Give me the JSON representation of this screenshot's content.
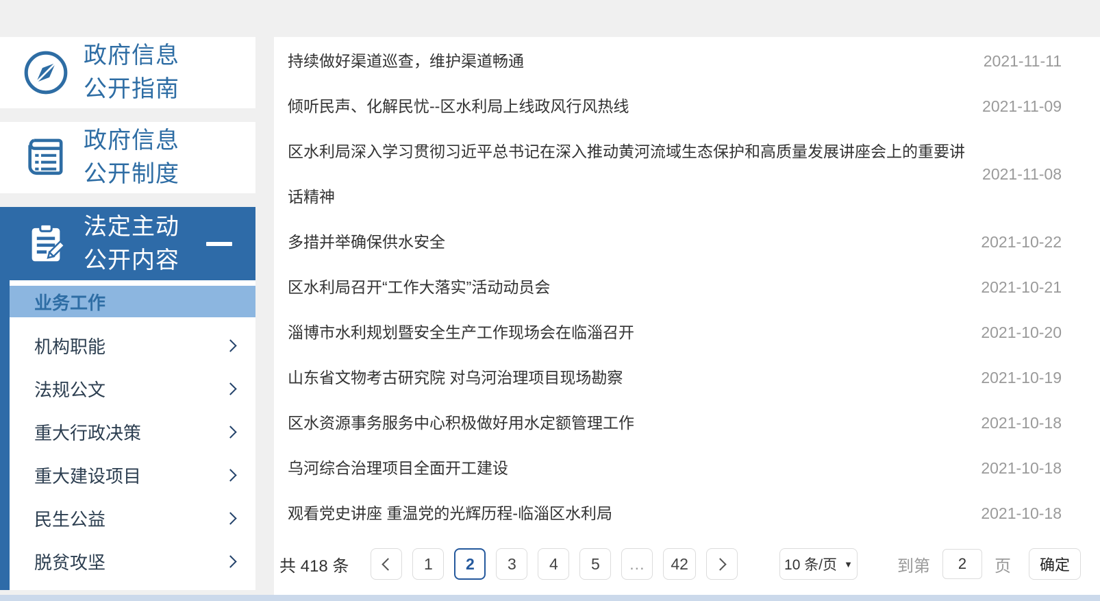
{
  "sidebar": {
    "nav": [
      {
        "line1": "政府信息",
        "line2": "公开指南",
        "icon": "compass-icon"
      },
      {
        "line1": "政府信息",
        "line2": "公开制度",
        "icon": "book-icon"
      },
      {
        "line1": "法定主动",
        "line2": "公开内容",
        "icon": "clipboard-pencil-icon",
        "state": "expanded"
      }
    ],
    "submenu": [
      {
        "label": "业务工作",
        "active": true
      },
      {
        "label": "机构职能"
      },
      {
        "label": "法规公文"
      },
      {
        "label": "重大行政决策"
      },
      {
        "label": "重大建设项目"
      },
      {
        "label": "民生公益"
      },
      {
        "label": "脱贫攻坚"
      }
    ]
  },
  "news": {
    "items": [
      {
        "title": "持续做好渠道巡查，维护渠道畅通",
        "date": "2021-11-11"
      },
      {
        "title": "倾听民声、化解民忧--区水利局上线政风行风热线",
        "date": "2021-11-09"
      },
      {
        "title": "区水利局深入学习贯彻习近平总书记在深入推动黄河流域生态保护和高质量发展讲座会上的重要讲话精神",
        "date": "2021-11-08"
      },
      {
        "title": "多措并举确保供水安全",
        "date": "2021-10-22"
      },
      {
        "title": "区水利局召开“工作大落实”活动动员会",
        "date": "2021-10-21"
      },
      {
        "title": "淄博市水利规划暨安全生产工作现场会在临淄召开",
        "date": "2021-10-20"
      },
      {
        "title": "山东省文物考古研究院 对乌河治理项目现场勘察",
        "date": "2021-10-19"
      },
      {
        "title": "区水资源事务服务中心积极做好用水定额管理工作",
        "date": "2021-10-18"
      },
      {
        "title": "乌河综合治理项目全面开工建设",
        "date": "2021-10-18"
      },
      {
        "title": "观看党史讲座 重温党的光辉历程-临淄区水利局",
        "date": "2021-10-18"
      }
    ]
  },
  "pagination": {
    "total_label": "共 418 条",
    "pages": [
      "1",
      "2",
      "3",
      "4",
      "5",
      "...",
      "42"
    ],
    "active_page": "2",
    "page_size_label": "10 条/页",
    "caret_glyph": "▼",
    "goto_prefix": "到第",
    "goto_value": "2",
    "goto_suffix": "页",
    "confirm_label": "确定"
  },
  "colors": {
    "primary_blue": "#2e6ba8",
    "link_blue": "#2e6da4",
    "active_sub_bg": "#8cb6e0",
    "date_gray": "#9a9a9a"
  }
}
